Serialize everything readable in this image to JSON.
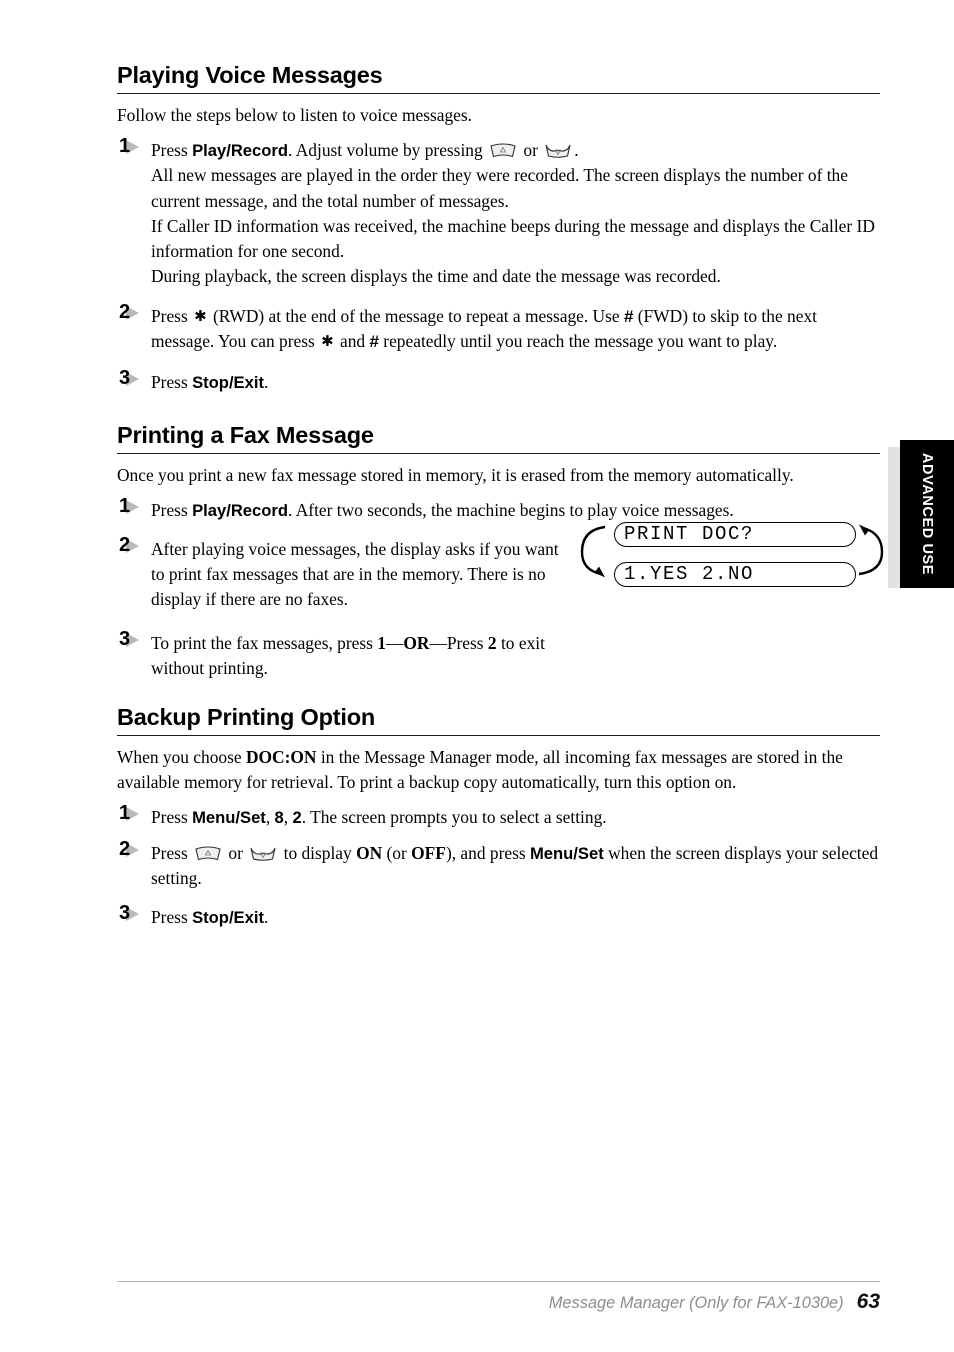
{
  "page": {
    "number": "63",
    "footer_note": "Message Manager (Only for FAX-1030e)",
    "side_tab_label": "ADVANCED USE"
  },
  "sections": [
    {
      "id": "playing-voice-messages",
      "heading": "Playing Voice Messages",
      "intro": "Follow the steps below to listen to voice messages.",
      "steps": [
        {
          "number": "1",
          "lines": [
            "Press Play/Record. Adjust volume by pressing  ▼  or  ▲ .",
            "All new messages are played in the order they were recorded. The screen displays the number of the current message, and the total number of messages.",
            "If Caller ID information was received, the machine beeps during the message and displays the Caller ID information for one second.",
            "During playback, the screen displays the time and date the message was recorded."
          ]
        },
        {
          "number": "2",
          "lines": [
            "Press ✻ (RWD) at the end of the message to repeat a message. Use # (FWD) to skip to the next message. You can press ✻ and # repeatedly until you reach the message you want to play."
          ]
        },
        {
          "number": "3",
          "lines": [
            "Press Stop/Exit."
          ]
        }
      ]
    },
    {
      "id": "printing-a-fax-message",
      "heading": "Printing a Fax Message",
      "intro": "Once you print a new fax message stored in memory, it is erased from the memory automatically.",
      "steps": [
        {
          "number": "1",
          "lines": [
            "Press Play/Record. After two seconds, the machine begins to play voice messages."
          ]
        },
        {
          "number": "2",
          "lines": [
            "After playing voice messages, the display asks if you want to print fax messages that are in the memory. There is no display if there are no faxes."
          ]
        },
        {
          "number": "3",
          "lines": [
            "To print the fax messages, press 1—OR—Press 2 to exit without printing."
          ]
        }
      ]
    },
    {
      "id": "backup-printing-option",
      "heading": "Backup Printing Option",
      "intro": "When you choose DOC:ON in the Message Manager mode, all incoming fax messages are stored in the available memory for retrieval. To print a backup copy automatically, turn this option on.",
      "steps": [
        {
          "number": "1",
          "lines": [
            "Press Menu/Set, 8, 2. The screen prompts you to select a setting."
          ]
        },
        {
          "number": "2",
          "lines": [
            "Press ▼ or ▲ to display ON (or OFF), and press Menu/Set when the screen displays your selected setting."
          ]
        },
        {
          "number": "3",
          "lines": [
            "Press Stop/Exit."
          ]
        }
      ]
    }
  ],
  "lcd_figure": {
    "line1": "PRINT DOC?",
    "line2": "1.YES 2.NO",
    "arrow_left": "curved-arrow-down",
    "arrow_right": "curved-arrow-up"
  },
  "labels": {
    "play_record": "Play/Record",
    "stop_exit": "Stop/Exit",
    "menu_set": "Menu/Set",
    "doc_on": "DOC:ON",
    "on": "ON",
    "off": "OFF",
    "or": "OR",
    "rwd": "(RWD)",
    "fwd": "(FWD)",
    "digit_8": "8",
    "digit_2": "2",
    "digit_1": "1",
    "press": "Press",
    "use": "Use"
  },
  "colors": {
    "text": "#000000",
    "rule": "#1a1a1a",
    "step_triangle": "#b9b9b9",
    "tab_background": "#000000",
    "tab_text": "#ffffff",
    "tab_shadow": "#e2e2e2",
    "footer_note": "#8d8d8d",
    "footer_rule": "#b5b5b5"
  }
}
